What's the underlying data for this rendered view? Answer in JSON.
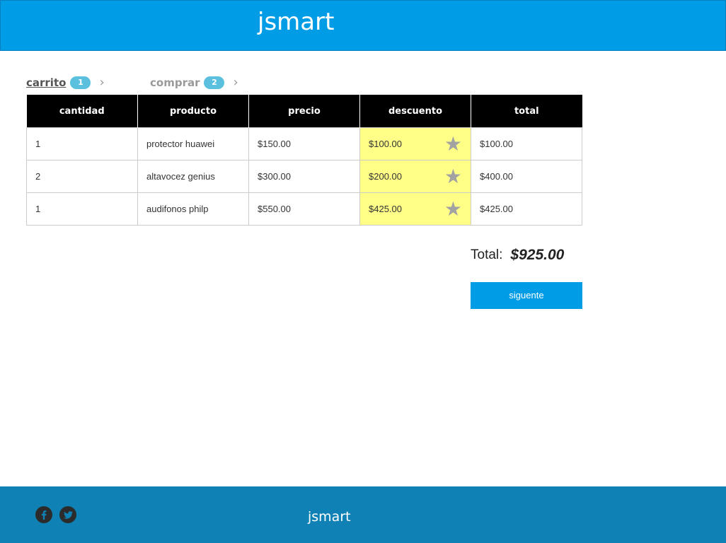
{
  "header": {
    "title": "jsmart",
    "background": "#009de6"
  },
  "steps": [
    {
      "label": "carrito",
      "badge": "1",
      "active": true
    },
    {
      "label": "comprar",
      "badge": "2",
      "active": false
    }
  ],
  "cart": {
    "columns": [
      "cantidad",
      "producto",
      "precio",
      "descuento",
      "total"
    ],
    "rows": [
      {
        "cantidad": "1",
        "producto": "protector huawei",
        "precio": "$150.00",
        "descuento": "$100.00",
        "total": "$100.00"
      },
      {
        "cantidad": "2",
        "producto": "altavocez genius",
        "precio": "$300.00",
        "descuento": "$200.00",
        "total": "$400.00"
      },
      {
        "cantidad": "1",
        "producto": "audifonos philp",
        "precio": "$550.00",
        "descuento": "$425.00",
        "total": "$425.00"
      }
    ],
    "discount_icon": "star-icon",
    "discount_highlight": "#ffff88"
  },
  "summary": {
    "total_label": "Total:",
    "total_value": "$925.00"
  },
  "actions": {
    "next_label": "siguente",
    "color": "#009de6"
  },
  "footer": {
    "title": "jsmart",
    "background": "#1081b5",
    "social": [
      "facebook-icon",
      "twitter-icon"
    ]
  }
}
